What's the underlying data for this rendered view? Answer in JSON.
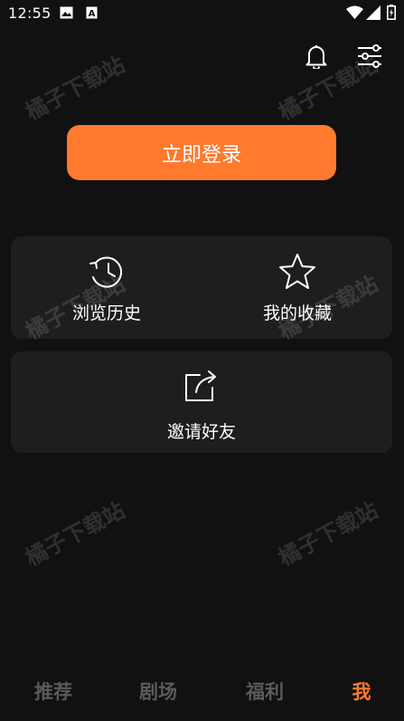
{
  "status_bar": {
    "time": "12:55",
    "icons": [
      "image-notification-icon",
      "a-notification-icon",
      "wifi-icon",
      "signal-icon",
      "battery-icon"
    ]
  },
  "header": {
    "icons": [
      "bell-icon",
      "filter-settings-icon"
    ]
  },
  "login": {
    "label": "立即登录",
    "color": "#ff7a2f"
  },
  "quick_actions": [
    {
      "label": "浏览历史",
      "icon": "history-icon"
    },
    {
      "label": "我的收藏",
      "icon": "star-icon"
    }
  ],
  "invite": {
    "label": "邀请好友",
    "icon": "share-icon"
  },
  "watermark": "橘子下载站",
  "bottom_nav": {
    "items": [
      {
        "label": "推荐",
        "active": false
      },
      {
        "label": "剧场",
        "active": false
      },
      {
        "label": "福利",
        "active": false
      },
      {
        "label": "我",
        "active": true
      }
    ],
    "active_color": "#ff7a2f",
    "inactive_color": "#5a5a5a"
  },
  "colors": {
    "background": "#111111",
    "card": "#1e1e1e",
    "accent": "#ff7a2f"
  }
}
